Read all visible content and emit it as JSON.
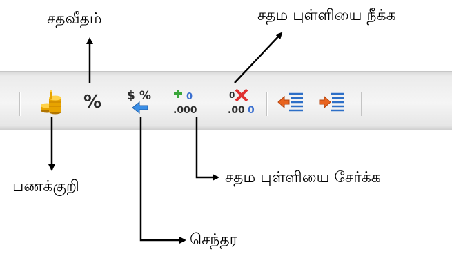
{
  "labels": {
    "percent": "சதவீதம்",
    "remove_decimal": "சதம புள்ளியை நீக்க",
    "currency": "பணக்குறி",
    "add_decimal": "சதம புள்ளியை சேர்க்க",
    "standard": "செந்தர"
  },
  "toolbar": {
    "percent_symbol": "%",
    "icons": [
      "currency-coins-icon",
      "percent-style-icon",
      "standard-format-icon",
      "add-decimal-icon",
      "remove-decimal-icon",
      "decrease-indent-icon",
      "increase-indent-icon"
    ]
  }
}
